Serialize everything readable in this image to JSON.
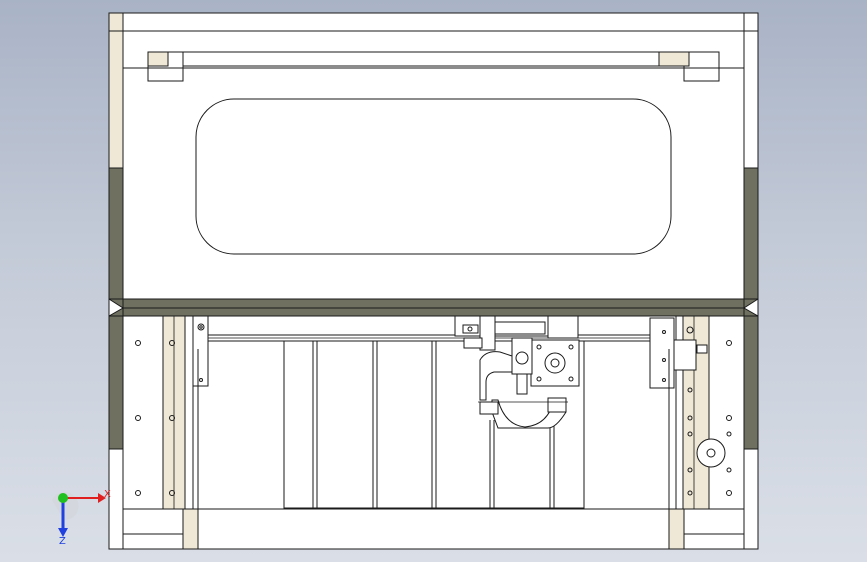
{
  "colors": {
    "frame_fill": "#ffffff",
    "edge_line": "#1a1a1a",
    "rail_dark": "#6f705f",
    "beige_strip": "#efe8d6",
    "axis_x": "#e02020",
    "axis_y": "#20c020",
    "axis_z": "#2040e0",
    "background_top": "#a9b3c6",
    "background_bottom": "#dadfe7"
  },
  "triad": {
    "x_label": "X",
    "z_label": "Z",
    "icons": [
      "axis-x-arrow-icon",
      "axis-y-dot-icon",
      "axis-z-arrow-icon"
    ]
  }
}
